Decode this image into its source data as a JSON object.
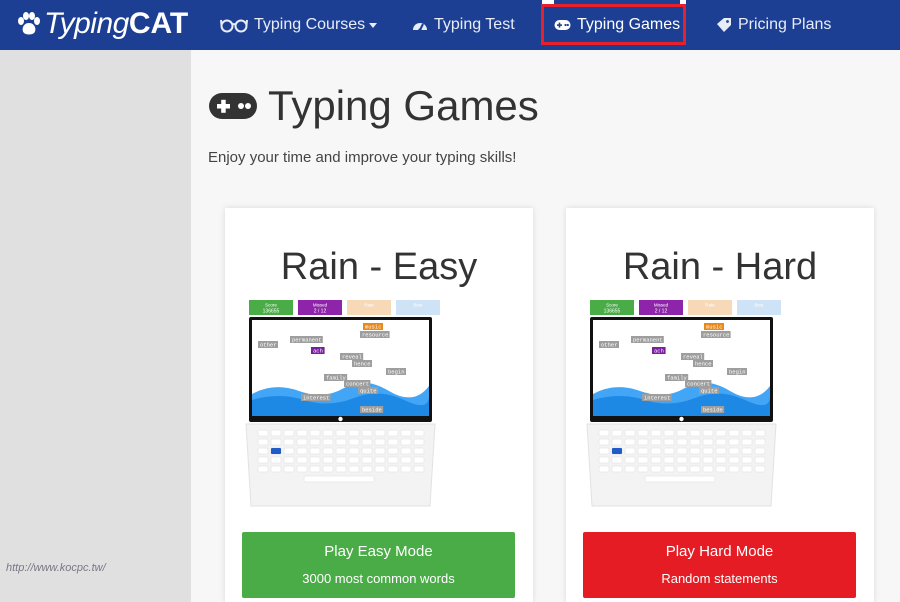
{
  "brand": {
    "part1": "Typing",
    "part2": "CAT"
  },
  "nav": {
    "courses": "Typing Courses",
    "test": "Typing Test",
    "games": "Typing Games",
    "pricing": "Pricing Plans"
  },
  "page": {
    "title": "Typing Games",
    "subtitle": "Enjoy your time and improve your typing skills!"
  },
  "preview": {
    "stats": [
      {
        "label": "Score",
        "value": "136655",
        "color": "#4aac47"
      },
      {
        "label": "Missed",
        "value": "2 / 12",
        "color": "#8e24aa"
      },
      {
        "label": "Rate",
        "value": "",
        "color": "#f7d9b8"
      },
      {
        "label": "Best",
        "value": "",
        "color": "#cfe3f7"
      }
    ],
    "words": [
      "music",
      "resource",
      "other",
      "permanent",
      "ach",
      "reveal",
      "hence",
      "begin",
      "family",
      "concert",
      "quite",
      "interest",
      "beside"
    ]
  },
  "games": [
    {
      "title": "Rain - Easy",
      "button": "Play Easy Mode",
      "description": "3000 most common words",
      "color": "#4aac47"
    },
    {
      "title": "Rain - Hard",
      "button": "Play Hard Mode",
      "description": "Random statements",
      "color": "#e51c24"
    }
  ],
  "watermark": "http://www.kocpc.tw/"
}
